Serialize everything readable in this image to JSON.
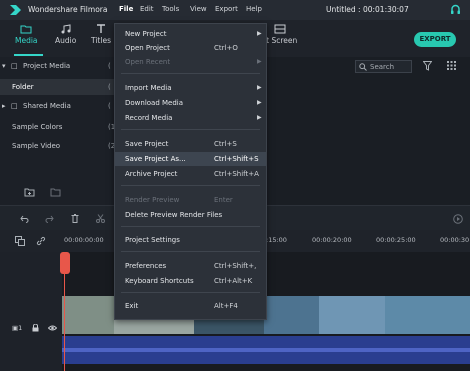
{
  "app": {
    "name": "Wondershare Filmora",
    "project_title": "Untitled : 00:01:30:07"
  },
  "menubar": {
    "items": [
      "File",
      "Edit",
      "Tools",
      "View",
      "Export",
      "Help"
    ]
  },
  "toolbar": {
    "tabs": [
      "Media",
      "Audio",
      "Titles"
    ],
    "split_screen": "lit Screen",
    "export_label": "EXPORT"
  },
  "left_panel": {
    "project_media": "Project Media",
    "project_media_count": "(",
    "folder": "Folder",
    "folder_count": "(",
    "shared_media": "Shared Media",
    "shared_media_count": "(",
    "sample_colors": "Sample Colors",
    "sample_colors_count": "(1",
    "sample_video": "Sample Video",
    "sample_video_count": "(2"
  },
  "search": {
    "placeholder": "Search"
  },
  "file_menu": {
    "new_project": "New Project",
    "open_project": "Open Project",
    "open_project_sc": "Ctrl+O",
    "open_recent": "Open Recent",
    "import_media": "Import Media",
    "download_media": "Download Media",
    "record_media": "Record Media",
    "save_project": "Save Project",
    "save_project_sc": "Ctrl+S",
    "save_project_as": "Save Project As...",
    "save_project_as_sc": "Ctrl+Shift+S",
    "archive_project": "Archive Project",
    "archive_project_sc": "Ctrl+Shift+A",
    "render_preview": "Render Preview",
    "render_preview_sc": "Enter",
    "delete_preview": "Delete Preview Render Files",
    "project_settings": "Project Settings",
    "preferences": "Preferences",
    "preferences_sc": "Ctrl+Shift+,",
    "keyboard_shortcuts": "Keyboard Shortcuts",
    "keyboard_shortcuts_sc": "Ctrl+Alt+K",
    "exit": "Exit",
    "exit_sc": "Alt+F4"
  },
  "timeline": {
    "timecodes": [
      "00:00:00:00",
      ":15:00",
      "00:00:20:00",
      "00:00:25:00",
      "00:00:30:0"
    ]
  },
  "colors": {
    "accent": "#35d6c9",
    "playhead": "#e8574a",
    "audio": "#2a3e8f"
  }
}
